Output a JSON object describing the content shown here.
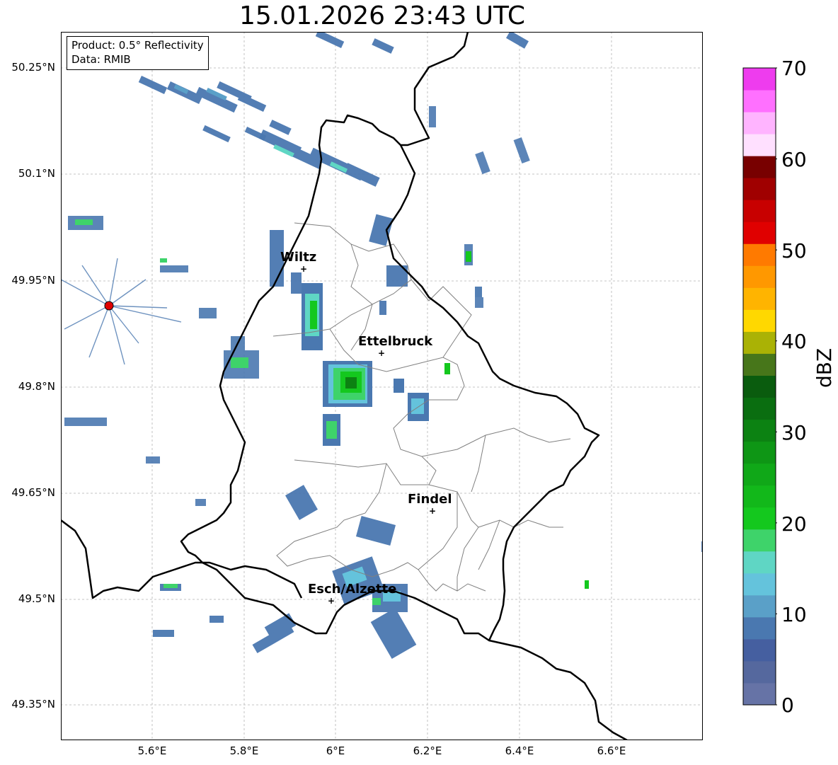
{
  "title": "15.01.2026 23:43 UTC",
  "info": {
    "product": "Product: 0.5° Reflectivity",
    "data": "Data: RMIB"
  },
  "axes": {
    "lat_labels": [
      "50.25°N",
      "50.1°N",
      "49.95°N",
      "49.8°N",
      "49.65°N",
      "49.5°N",
      "49.35°N"
    ],
    "lon_labels": [
      "5.6°E",
      "5.8°E",
      "6°E",
      "6.2°E",
      "6.4°E",
      "6.6°E"
    ]
  },
  "cities": [
    {
      "name": "Wiltz",
      "lon": 5.93,
      "lat": 49.965
    },
    {
      "name": "Ettelbruck",
      "lon": 6.1,
      "lat": 49.85
    },
    {
      "name": "Findel",
      "lon": 6.21,
      "lat": 49.627
    },
    {
      "name": "Esch/Alzette",
      "lon": 5.99,
      "lat": 49.5
    }
  ],
  "radar_site": {
    "lon": 5.505,
    "lat": 49.915
  },
  "colorbar": {
    "label": "dBZ",
    "ticks": [
      "0",
      "10",
      "20",
      "30",
      "40",
      "50",
      "60",
      "70"
    ],
    "colors": [
      "#6673a6",
      "#55689e",
      "#455fa0",
      "#4a78b0",
      "#5aa0c8",
      "#64c3dc",
      "#5fd6c4",
      "#3ed36a",
      "#14c81e",
      "#12b81a",
      "#10a818",
      "#0e9615",
      "#0c8212",
      "#0a6e10",
      "#0a5c0e",
      "#47761a",
      "#aab205",
      "#ffd800",
      "#ffb400",
      "#ff9800",
      "#ff7a00",
      "#e00000",
      "#c80000",
      "#a00000",
      "#780000",
      "#ffe0ff",
      "#ffb4ff",
      "#ff70ff",
      "#ee3cee"
    ]
  }
}
